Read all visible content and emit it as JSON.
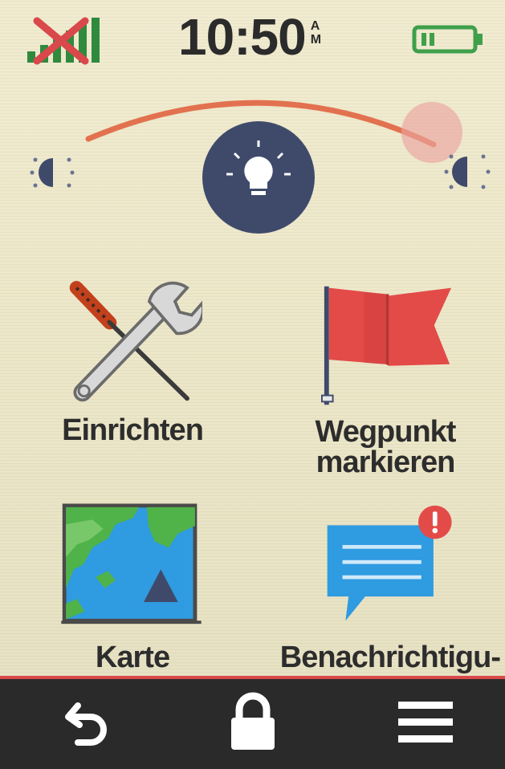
{
  "status_bar": {
    "time": "10:50",
    "ampm_top": "A",
    "ampm_bottom": "M",
    "signal_icon": "no-signal-icon",
    "battery_icon": "battery-low-icon",
    "colors": {
      "signal": "#2f8a3e",
      "signal_cross": "#d9484a",
      "battery": "#3fa04b"
    }
  },
  "brightness": {
    "icon": "lightbulb-icon",
    "left_icon": "brightness-low-icon",
    "right_icon": "brightness-high-icon",
    "colors": {
      "arc": "#e2714f",
      "knob": "#3f4a6b"
    }
  },
  "apps": [
    {
      "label": "Einrichten",
      "icon": "wrench-screwdriver-icon"
    },
    {
      "label_line1": "Wegpunkt",
      "label_line2": "markieren",
      "icon": "flag-icon"
    },
    {
      "label": "Karte",
      "icon": "map-icon"
    },
    {
      "label": "Benachrichtigu-",
      "icon": "message-alert-icon",
      "badge": "!"
    }
  ],
  "bottom_bar": {
    "back_icon": "back-arrow-icon",
    "lock_icon": "lock-icon",
    "menu_icon": "menu-icon",
    "colors": {
      "background": "#2a2a2a",
      "accent": "#d9484a"
    }
  }
}
